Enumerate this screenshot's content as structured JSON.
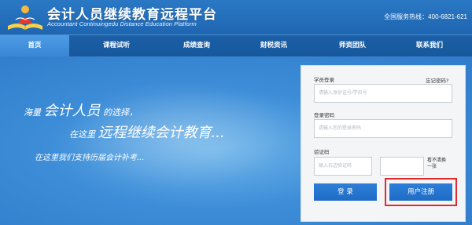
{
  "header": {
    "title": "会计人员继续教育远程平台",
    "subtitle": "Accountant Continuingedu Distance Education Platform",
    "hotline": "全国服务热线：400-6821-621"
  },
  "nav": {
    "items": [
      "首页",
      "课程试听",
      "成绩查询",
      "财税资讯",
      "师资团队",
      "联系我们"
    ],
    "active_index": 0
  },
  "banner": {
    "line1_prefix": "海量",
    "line1_em": "会计人员",
    "line1_suffix": "的选择，",
    "line2_prefix": "在这里",
    "line2_em": "远程继续会计教育...",
    "line3": "在这里我们支持历届会计补考..."
  },
  "login": {
    "username_label": "学员登录",
    "forgot_label": "忘记密码?",
    "username_placeholder": "请输入身份证号/学员号",
    "password_label": "登录密码",
    "password_placeholder": "请输入您的登录密码",
    "captcha_label": "验证码",
    "captcha_placeholder": "输入右边验证码",
    "refresh_label": "看不清换一张",
    "login_button": "登 录",
    "register_button": "用户注册"
  },
  "colors": {
    "header_bg": "#2270bb",
    "nav_bg": "#1c5fa6",
    "nav_active": "#4d9be4",
    "button": "#2475cf",
    "highlight": "#e02b2b"
  }
}
